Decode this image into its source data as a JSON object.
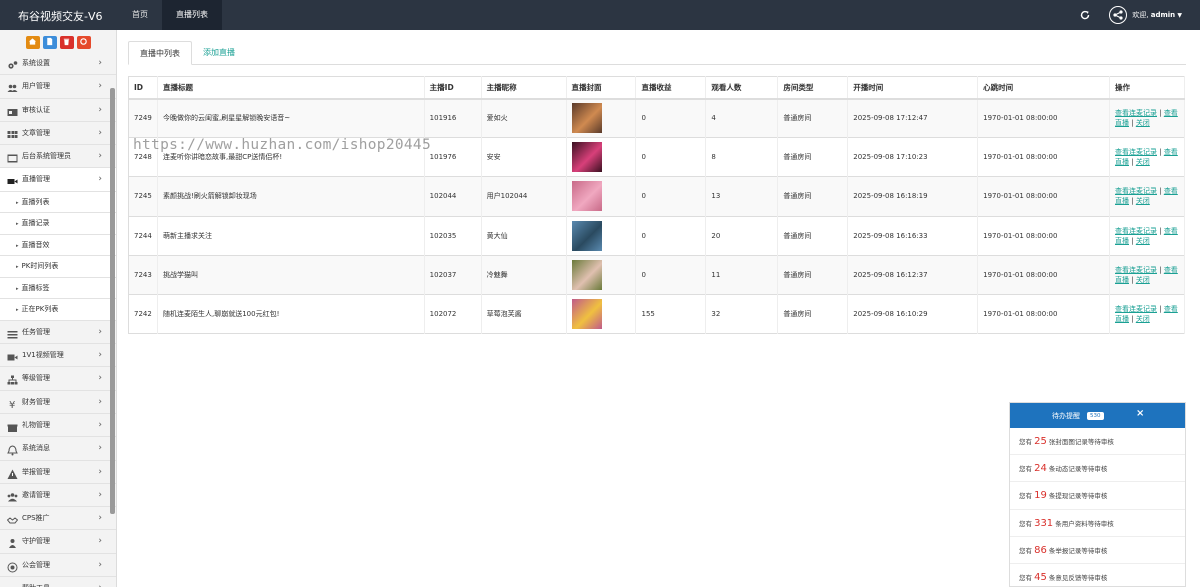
{
  "brand": "布谷视频交友-V6",
  "topnav": [
    "首页",
    "直播列表"
  ],
  "user": {
    "welcome": "欢迎,",
    "name": "admin"
  },
  "quick_buttons": [
    {
      "icon": "home-icon",
      "color": "#e38b12"
    },
    {
      "icon": "document-icon",
      "color": "#3c8dda"
    },
    {
      "icon": "trash-icon",
      "color": "#d9302b"
    },
    {
      "icon": "recycle-icon",
      "color": "#e54a2c"
    }
  ],
  "sidebar": [
    {
      "label": "系统设置",
      "icon": "gears-icon"
    },
    {
      "label": "用户管理",
      "icon": "users-icon"
    },
    {
      "label": "审核认证",
      "icon": "id-card-icon"
    },
    {
      "label": "文章管理",
      "icon": "grid-icon"
    },
    {
      "label": "后台系统管理员",
      "icon": "admin-icon"
    },
    {
      "label": "直播管理",
      "icon": "video-icon",
      "open": true,
      "children": [
        "直播列表",
        "直播记录",
        "直播音效",
        "PK时间列表",
        "直播标签",
        "正在PK列表"
      ]
    },
    {
      "label": "任务管理",
      "icon": "list-icon"
    },
    {
      "label": "1V1视频管理",
      "icon": "video-call-icon"
    },
    {
      "label": "等级管理",
      "icon": "sitemap-icon"
    },
    {
      "label": "财务管理",
      "icon": "yen-icon"
    },
    {
      "label": "礼物管理",
      "icon": "gift-icon"
    },
    {
      "label": "系统消息",
      "icon": "bell-icon"
    },
    {
      "label": "举报管理",
      "icon": "warning-icon"
    },
    {
      "label": "邀请管理",
      "icon": "group-icon"
    },
    {
      "label": "CPS推广",
      "icon": "handshake-icon"
    },
    {
      "label": "守护管理",
      "icon": "guard-icon"
    },
    {
      "label": "公会管理",
      "icon": "guild-icon"
    },
    {
      "label": "帮助工具",
      "icon": "tool-icon"
    }
  ],
  "tabs": [
    "直播中列表",
    "添加直播"
  ],
  "table": {
    "columns": [
      "ID",
      "直播标题",
      "主播ID",
      "主播昵称",
      "直播封面",
      "直播收益",
      "观看人数",
      "房间类型",
      "开播时间",
      "心跳时间",
      "操作"
    ],
    "rows": [
      {
        "id": "7249",
        "title": "今晚做你的云闺蜜,刷星星解锁晚安语音~",
        "anchor_id": "101916",
        "nickname": "爱如火",
        "cover": [
          "#5a3a2a",
          "#d08a50"
        ],
        "income": "0",
        "viewers": "4",
        "room_type": "普通房间",
        "start": "2025-09-08 17:12:47",
        "heartbeat": "1970-01-01 08:00:00"
      },
      {
        "id": "7248",
        "title": "连麦听你讲暗恋故事,最甜CP送情侣杯!",
        "anchor_id": "101976",
        "nickname": "安安",
        "cover": [
          "#3a1020",
          "#d8407a"
        ],
        "income": "0",
        "viewers": "8",
        "room_type": "普通房间",
        "start": "2025-09-08 17:10:23",
        "heartbeat": "1970-01-01 08:00:00"
      },
      {
        "id": "7245",
        "title": "素颜挑战!刷火箭解锁卸妆现场",
        "anchor_id": "102044",
        "nickname": "用户102044",
        "cover": [
          "#c86a88",
          "#f0a8c0"
        ],
        "income": "0",
        "viewers": "13",
        "room_type": "普通房间",
        "start": "2025-09-08 16:18:19",
        "heartbeat": "1970-01-01 08:00:00"
      },
      {
        "id": "7244",
        "title": "萌新主播求关注",
        "anchor_id": "102035",
        "nickname": "黄大仙",
        "cover": [
          "#5a8ab0",
          "#2a4a60"
        ],
        "income": "0",
        "viewers": "20",
        "room_type": "普通房间",
        "start": "2025-09-08 16:16:33",
        "heartbeat": "1970-01-01 08:00:00"
      },
      {
        "id": "7243",
        "title": "挑战学猫叫",
        "anchor_id": "102037",
        "nickname": "冷魅舞",
        "cover": [
          "#6a7a3a",
          "#e0c0b0"
        ],
        "income": "0",
        "viewers": "11",
        "room_type": "普通房间",
        "start": "2025-09-08 16:12:37",
        "heartbeat": "1970-01-01 08:00:00"
      },
      {
        "id": "7242",
        "title": "随机连麦陌生人,聊崩就送100元红包!",
        "anchor_id": "102072",
        "nickname": "草莓泡芙酱",
        "cover": [
          "#c05a8a",
          "#f0c040"
        ],
        "income": "155",
        "viewers": "32",
        "room_type": "普通房间",
        "start": "2025-09-08 16:10:29",
        "heartbeat": "1970-01-01 08:00:00"
      }
    ],
    "ops": {
      "view": "查看连麦记录",
      "sep": "|",
      "view2": "查看直播",
      "close": "关闭"
    }
  },
  "watermark": "https://www.huzhan.com/ishop20445",
  "reminder": {
    "title": "待办提醒",
    "badge": "530",
    "close": "×",
    "items": [
      {
        "prefix": "您有",
        "num": "25",
        "suffix": "张封面图记录等待审核"
      },
      {
        "prefix": "您有",
        "num": "24",
        "suffix": "条动态记录等待审核"
      },
      {
        "prefix": "您有",
        "num": "19",
        "suffix": "条提现记录等待审核"
      },
      {
        "prefix": "您有",
        "num": "331",
        "suffix": "条用户资料等待审核"
      },
      {
        "prefix": "您有",
        "num": "86",
        "suffix": "条举报记录等待审核"
      },
      {
        "prefix": "您有",
        "num": "45",
        "suffix": "条意见反馈等待审核"
      }
    ]
  }
}
